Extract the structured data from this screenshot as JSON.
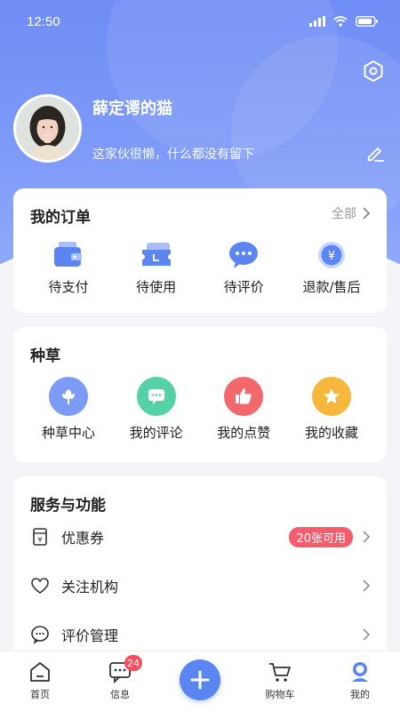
{
  "status_bar": {
    "time": "12:50"
  },
  "profile": {
    "username": "薛定谔的猫",
    "bio": "这家伙很懒，什么都没有留下"
  },
  "orders": {
    "title": "我的订单",
    "all_label": "全部",
    "items": [
      {
        "label": "待支付",
        "icon": "wallet-icon"
      },
      {
        "label": "待使用",
        "icon": "ticket-icon"
      },
      {
        "label": "待评价",
        "icon": "chat-bubble-icon"
      },
      {
        "label": "退款/售后",
        "icon": "yen-coin-icon"
      }
    ]
  },
  "grass": {
    "title": "种草",
    "items": [
      {
        "label": "种草中心",
        "icon": "flower-icon",
        "color": "#7b9bf5"
      },
      {
        "label": "我的评论",
        "icon": "comment-icon",
        "color": "#55d2a5"
      },
      {
        "label": "我的点赞",
        "icon": "thumbs-up-icon",
        "color": "#f3686c"
      },
      {
        "label": "我的收藏",
        "icon": "star-icon",
        "color": "#f7b63c"
      }
    ]
  },
  "services": {
    "title": "服务与功能",
    "items": [
      {
        "label": "优惠券",
        "icon": "coupon-icon",
        "badge": "20张可用"
      },
      {
        "label": "关注机构",
        "icon": "heart-icon"
      },
      {
        "label": "评价管理",
        "icon": "review-icon"
      }
    ]
  },
  "tabbar": {
    "items": [
      {
        "label": "首页",
        "icon": "home-icon"
      },
      {
        "label": "信息",
        "icon": "message-icon",
        "badge": "24"
      },
      {
        "label": "",
        "icon": "plus-icon"
      },
      {
        "label": "购物车",
        "icon": "cart-icon"
      },
      {
        "label": "我的",
        "icon": "profile-icon"
      }
    ]
  },
  "colors": {
    "brand": "#6f8df5",
    "accent": "#5b86f2",
    "badge": "#f55c6c"
  }
}
